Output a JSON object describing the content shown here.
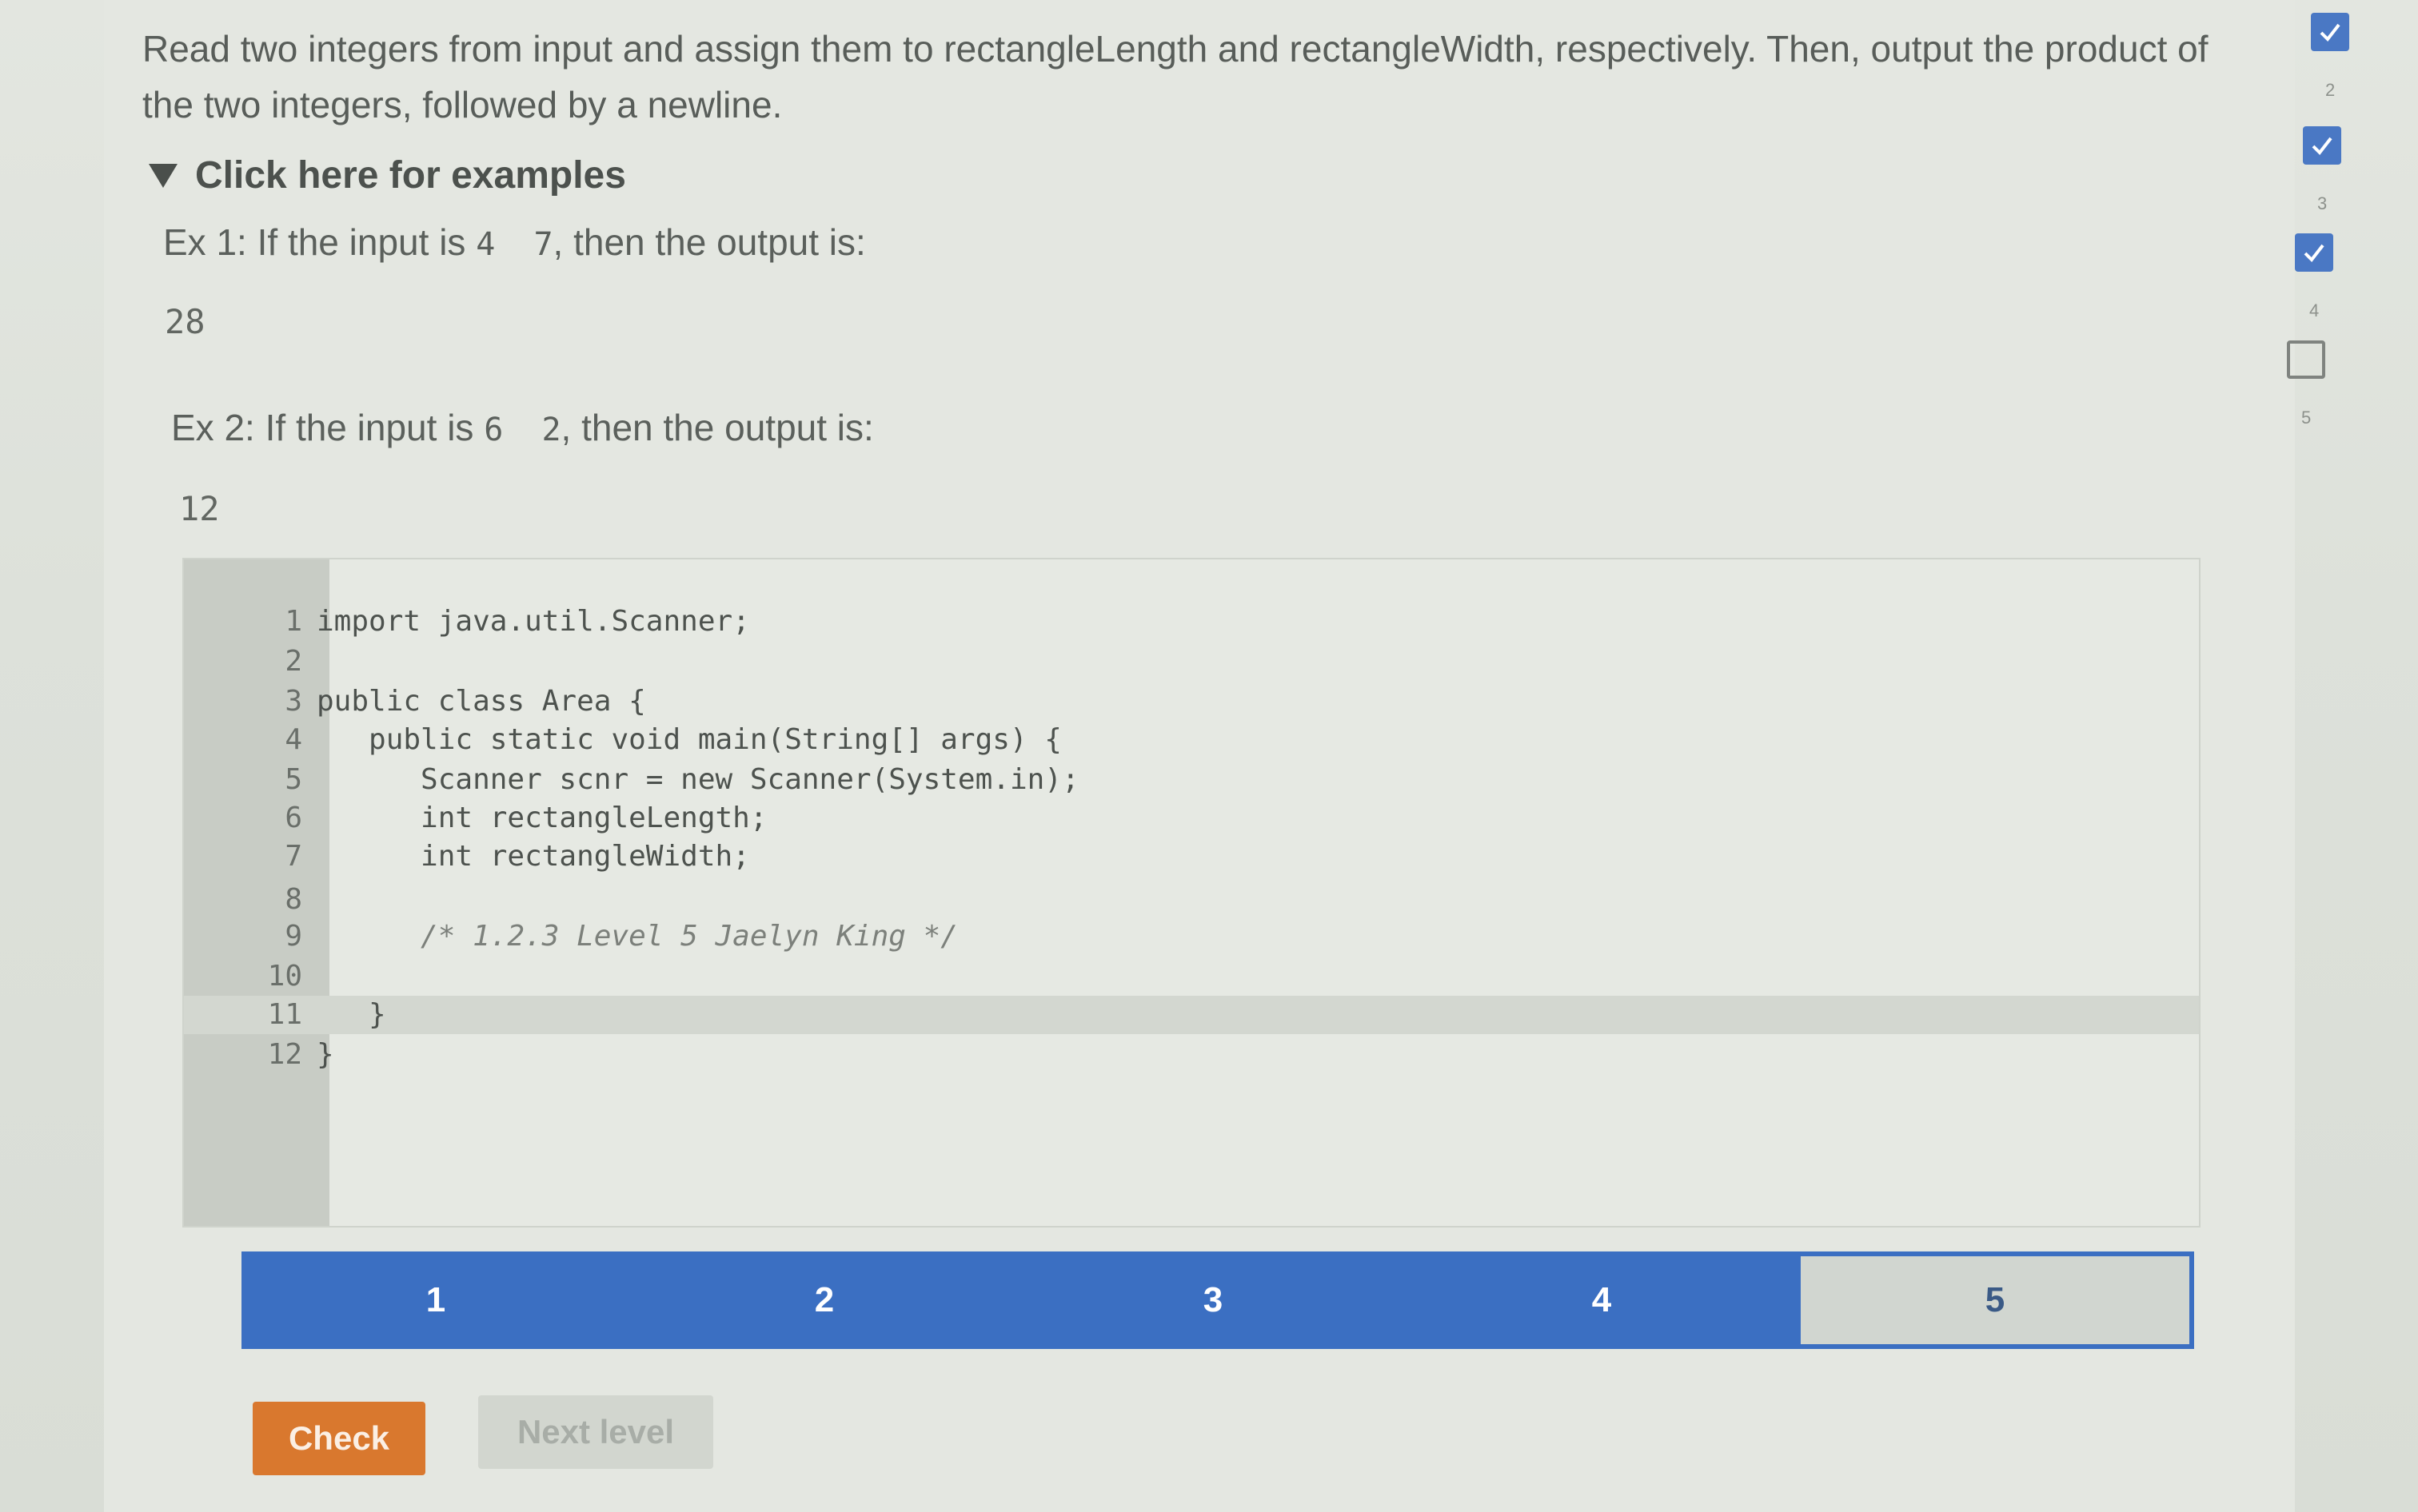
{
  "prompt": {
    "text": "Read two integers from input and assign them to rectangleLength and rectangleWidth, respectively. Then, output the product of the two integers, followed by a newline."
  },
  "examples": {
    "toggle_label": "Click here for examples",
    "ex1": {
      "prefix": "Ex 1: If the input is",
      "input": "4  7",
      "suffix": ", then the output is:",
      "output": "28"
    },
    "ex2": {
      "prefix": "Ex 2: If the input is",
      "input": "6  2",
      "suffix": ", then the output is:",
      "output": "12"
    }
  },
  "editor": {
    "lines": [
      {
        "num": "1",
        "code": "import java.util.Scanner;"
      },
      {
        "num": "2",
        "code": ""
      },
      {
        "num": "3",
        "code": "public class Area {"
      },
      {
        "num": "4",
        "code": "   public static void main(String[] args) {"
      },
      {
        "num": "5",
        "code": "      Scanner scnr = new Scanner(System.in);"
      },
      {
        "num": "6",
        "code": "      int rectangleLength;"
      },
      {
        "num": "7",
        "code": "      int rectangleWidth;"
      },
      {
        "num": "8",
        "code": ""
      },
      {
        "num": "9",
        "code": "      /* 1.2.3 Level 5 Jaelyn King */"
      },
      {
        "num": "10",
        "code": ""
      },
      {
        "num": "11",
        "code": "   }"
      },
      {
        "num": "12",
        "code": "}"
      }
    ],
    "active_line": "11"
  },
  "levels": {
    "items": [
      "1",
      "2",
      "3",
      "4",
      "5"
    ],
    "current": "5"
  },
  "buttons": {
    "check": "Check",
    "next": "Next level"
  },
  "checklist": [
    {
      "num": "2",
      "checked": true
    },
    {
      "num": "3",
      "checked": true
    },
    {
      "num": "4",
      "checked": true
    },
    {
      "num": "5",
      "checked": false
    }
  ],
  "colors": {
    "accent_blue": "#3b6fc2",
    "check_orange": "#d9782e"
  }
}
